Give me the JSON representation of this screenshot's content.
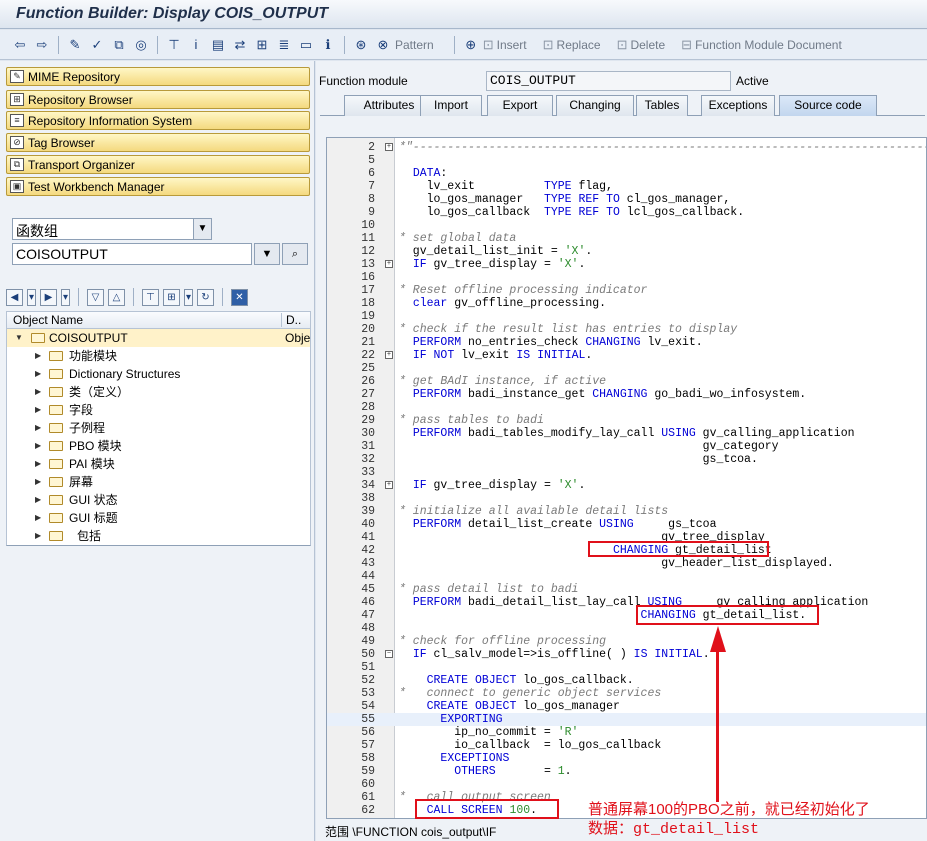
{
  "window": {
    "title": "Function Builder: Display COIS_OUTPUT"
  },
  "toolbar": {
    "pattern": "Pattern",
    "insert": "Insert",
    "replace": "Replace",
    "delete": "Delete",
    "fm_doc": "Function Module Document"
  },
  "nav": {
    "items": [
      "MIME Repository",
      "Repository Browser",
      "Repository Information System",
      "Tag Browser",
      "Transport Organizer",
      "Test Workbench Manager"
    ]
  },
  "object_type": {
    "value": "函数组"
  },
  "object_name": {
    "value": "COISOUTPUT"
  },
  "tree": {
    "col_name": "Object Name",
    "col_desc": "D..",
    "root": "COISOUTPUT",
    "root_desc": "Obje",
    "children": [
      "功能模块",
      "Dictionary Structures",
      "类（定义）",
      "字段",
      "子例程",
      "PBO 模块",
      "PAI 模块",
      "屏幕",
      "GUI 状态",
      "GUI 标题",
      "包括"
    ]
  },
  "header": {
    "fm_label": "Function module",
    "fm_value": "COIS_OUTPUT",
    "status": "Active"
  },
  "tabs": [
    "Attributes",
    "Import",
    "Export",
    "Changing",
    "Tables",
    "Exceptions",
    "Source code"
  ],
  "code": [
    [
      "2",
      "*\"---------------------------------------------------------------------------"
    ],
    [
      "5",
      ""
    ],
    [
      "6",
      "  DATA:"
    ],
    [
      "7",
      "    lv_exit          TYPE flag,"
    ],
    [
      "8",
      "    lo_gos_manager   TYPE REF TO cl_gos_manager,"
    ],
    [
      "9",
      "    lo_gos_callback  TYPE REF TO lcl_gos_callback."
    ],
    [
      "10",
      ""
    ],
    [
      "11",
      "* set global data"
    ],
    [
      "12",
      "  gv_detail_list_init = 'X'."
    ],
    [
      "13",
      "  IF gv_tree_display = 'X'."
    ],
    [
      "16",
      ""
    ],
    [
      "17",
      "* Reset offline processing indicator"
    ],
    [
      "18",
      "  clear gv_offline_processing."
    ],
    [
      "19",
      ""
    ],
    [
      "20",
      "* check if the result list has entries to display"
    ],
    [
      "21",
      "  PERFORM no_entries_check CHANGING lv_exit."
    ],
    [
      "22",
      "  IF NOT lv_exit IS INITIAL."
    ],
    [
      "25",
      ""
    ],
    [
      "26",
      "* get BAdI instance, if active"
    ],
    [
      "27",
      "  PERFORM badi_instance_get CHANGING go_badi_wo_infosystem."
    ],
    [
      "28",
      ""
    ],
    [
      "29",
      "* pass tables to badi"
    ],
    [
      "30",
      "  PERFORM badi_tables_modify_lay_call USING gv_calling_application"
    ],
    [
      "31",
      "                                            gv_category"
    ],
    [
      "32",
      "                                            gs_tcoa."
    ],
    [
      "33",
      ""
    ],
    [
      "34",
      "  IF gv_tree_display = 'X'."
    ],
    [
      "38",
      ""
    ],
    [
      "39",
      "* initialize all available detail lists"
    ],
    [
      "40",
      "  PERFORM detail_list_create USING     gs_tcoa"
    ],
    [
      "41",
      "                                      gv_tree_display"
    ],
    [
      "42",
      "                               CHANGING gt_detail_list"
    ],
    [
      "43",
      "                                      gv_header_list_displayed."
    ],
    [
      "44",
      ""
    ],
    [
      "45",
      "* pass detail list to badi"
    ],
    [
      "46",
      "  PERFORM badi_detail_list_lay_call USING     gv_calling_application"
    ],
    [
      "47",
      "                                   CHANGING gt_detail_list."
    ],
    [
      "48",
      ""
    ],
    [
      "49",
      "* check for offline processing"
    ],
    [
      "50",
      "  IF cl_salv_model=>is_offline( ) IS INITIAL."
    ],
    [
      "51",
      ""
    ],
    [
      "52",
      "    CREATE OBJECT lo_gos_callback."
    ],
    [
      "53",
      "*   connect to generic object services"
    ],
    [
      "54",
      "    CREATE OBJECT lo_gos_manager"
    ],
    [
      "55",
      "      EXPORTING"
    ],
    [
      "56",
      "        ip_no_commit = 'R'"
    ],
    [
      "57",
      "        io_callback  = lo_gos_callback"
    ],
    [
      "58",
      "      EXCEPTIONS"
    ],
    [
      "59",
      "        OTHERS       = 1."
    ],
    [
      "60",
      ""
    ],
    [
      "61",
      "*   call output screen"
    ],
    [
      "62",
      "    CALL SCREEN 100."
    ]
  ],
  "annotation": {
    "line1": "普通屏幕100的PBO之前，就已经初始化了",
    "line2": "数据：gt_detail_list"
  },
  "status": {
    "text": "范围 \\FUNCTION cois_output\\IF"
  }
}
